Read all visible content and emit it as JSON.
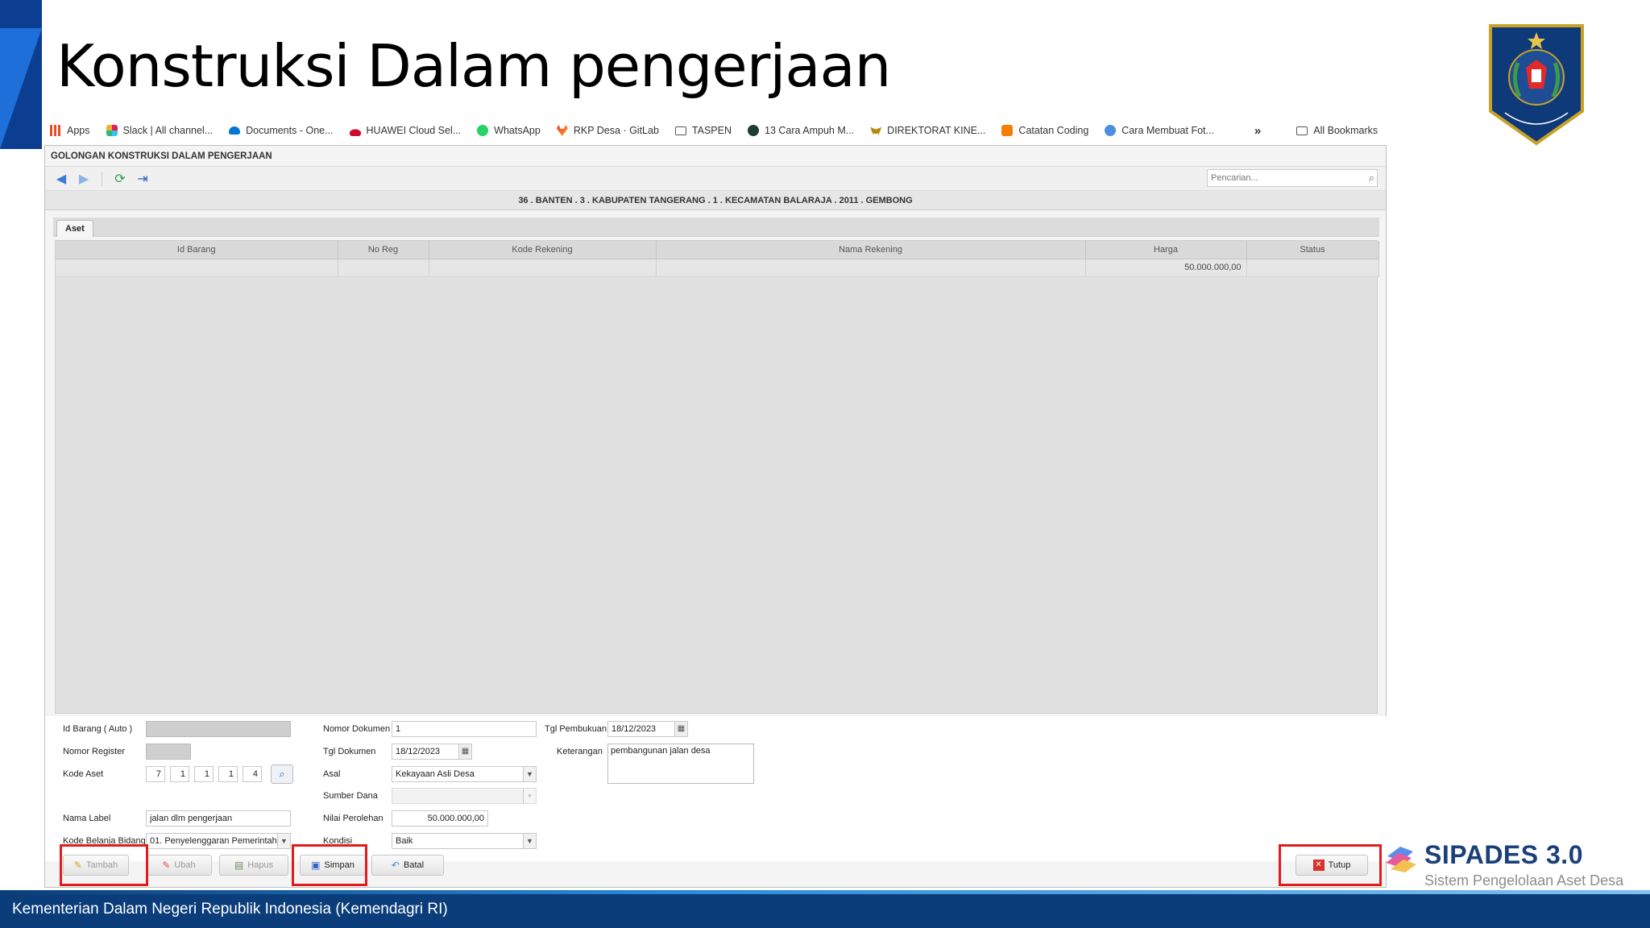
{
  "slide": {
    "title": "Konstruksi Dalam pengerjaan",
    "footer": "Kementerian Dalam Negeri Republik Indonesia (Kemendagri RI)"
  },
  "brand": {
    "title": "SIPADES 3.0",
    "subtitle": "Sistem Pengelolaan Aset Desa",
    "emblem_text": "KEMENTERIAN DALAM NEGERI"
  },
  "bookmarks": [
    {
      "label": "Apps",
      "icon": "apps-grid-icon",
      "color": "#e44d26"
    },
    {
      "label": "Slack | All channel...",
      "icon": "slack-icon",
      "color": "#e01e5a"
    },
    {
      "label": "Documents - One...",
      "icon": "onedrive-icon",
      "color": "#0078d4"
    },
    {
      "label": "HUAWEI Cloud Sel...",
      "icon": "huawei-icon",
      "color": "#cf0a2c"
    },
    {
      "label": "WhatsApp",
      "icon": "whatsapp-icon",
      "color": "#25d366"
    },
    {
      "label": "RKP Desa · GitLab",
      "icon": "gitlab-icon",
      "color": "#fc6d26"
    },
    {
      "label": "TASPEN",
      "icon": "folder-icon",
      "color": "#555555"
    },
    {
      "label": "13 Cara Ampuh M...",
      "icon": "site-icon",
      "color": "#1d3c34"
    },
    {
      "label": "DIREKTORAT KINE...",
      "icon": "garuda-icon",
      "color": "#b8860b"
    },
    {
      "label": "Catatan Coding",
      "icon": "blogger-icon",
      "color": "#f57d00"
    },
    {
      "label": "Cara Membuat Fot...",
      "icon": "site-icon",
      "color": "#4a90e2"
    }
  ],
  "bookmarks_overflow": "»",
  "all_bookmarks": "All Bookmarks",
  "app": {
    "title": "GOLONGAN KONSTRUKSI DALAM PENGERJAAN",
    "search_placeholder": "Pencarian...",
    "location": "36 . BANTEN . 3 . KABUPATEN TANGERANG . 1 . KECAMATAN BALARAJA . 2011 . GEMBONG",
    "tab": "Aset"
  },
  "grid": {
    "columns": [
      "Id Barang",
      "No Reg",
      "Kode Rekening",
      "Nama Rekening",
      "Harga",
      "Status"
    ],
    "rows": [
      [
        "",
        "",
        "",
        "",
        "50.000.000,00",
        ""
      ]
    ]
  },
  "form": {
    "id_barang_label": "Id Barang ( Auto )",
    "id_barang_value": "",
    "nomor_register_label": "Nomor Register",
    "nomor_register_value": "",
    "kode_aset_label": "Kode Aset",
    "kode_aset_parts": [
      "7",
      "1",
      "1",
      "1",
      "4"
    ],
    "nama_label_label": "Nama Label",
    "nama_label_value": "jalan dlm pengerjaan",
    "kode_belanja_label": "Kode Belanja Bidang",
    "kode_belanja_value": "01. Penyelenggaran Pemerintaha",
    "nomor_dokumen_label": "Nomor Dokumen",
    "nomor_dokumen_value": "1",
    "tgl_dokumen_label": "Tgl Dokumen",
    "tgl_dokumen_value": "18/12/2023",
    "asal_label": "Asal",
    "asal_value": "Kekayaan Asli Desa",
    "sumber_dana_label": "Sumber Dana",
    "sumber_dana_value": "",
    "nilai_perolehan_label": "Nilai Perolehan",
    "nilai_perolehan_value": "50.000.000,00",
    "kondisi_label": "Kondisi",
    "kondisi_value": "Baik",
    "tgl_pembukuan_label": "Tgl Pembukuan",
    "tgl_pembukuan_value": "18/12/2023",
    "keterangan_label": "Keterangan",
    "keterangan_value": "pembangunan jalan desa"
  },
  "buttons": {
    "tambah": "Tambah",
    "ubah": "Ubah",
    "hapus": "Hapus",
    "simpan": "Simpan",
    "batal": "Batal",
    "tutup": "Tutup"
  },
  "colors": {
    "highlight": "#e21b1b",
    "footer": "#0b3d7a",
    "brand": "#1b3f7a"
  }
}
